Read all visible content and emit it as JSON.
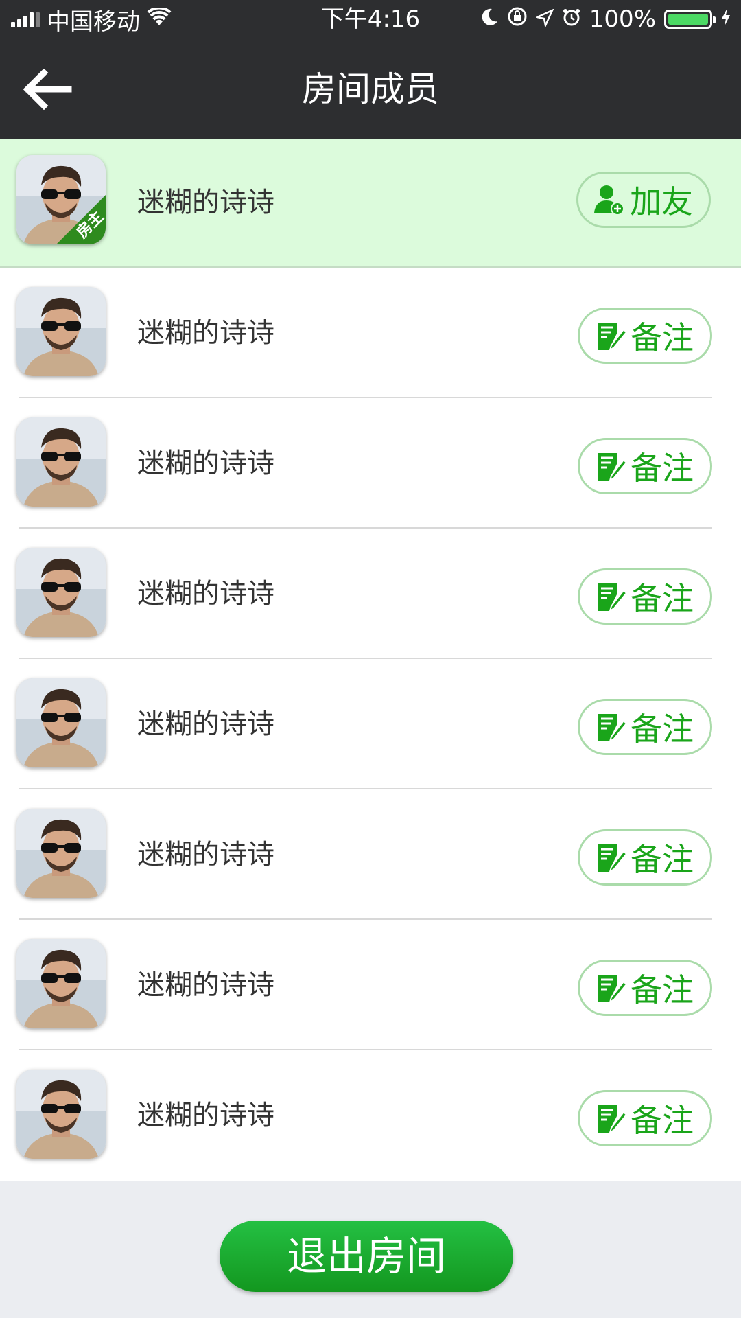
{
  "status_bar": {
    "carrier": "中国移动",
    "time": "下午4:16",
    "battery_percent": "100%",
    "icons": [
      "signal-icon",
      "wifi-icon",
      "moon-icon",
      "orientation-lock-icon",
      "location-icon",
      "alarm-icon",
      "battery-icon",
      "charging-icon"
    ]
  },
  "nav": {
    "title": "房间成员",
    "back_icon": "arrow-left-icon"
  },
  "colors": {
    "accent": "#1aa51a",
    "host_row_bg": "#dcfbdc",
    "nav_bg": "#2d2e30"
  },
  "members": [
    {
      "name": "迷糊的诗诗",
      "role_badge": "房主",
      "action_label": "加友",
      "action_icon": "add-friend-icon"
    },
    {
      "name": "迷糊的诗诗",
      "action_label": "备注",
      "action_icon": "edit-note-icon"
    },
    {
      "name": "迷糊的诗诗",
      "action_label": "备注",
      "action_icon": "edit-note-icon"
    },
    {
      "name": "迷糊的诗诗",
      "action_label": "备注",
      "action_icon": "edit-note-icon"
    },
    {
      "name": "迷糊的诗诗",
      "action_label": "备注",
      "action_icon": "edit-note-icon"
    },
    {
      "name": "迷糊的诗诗",
      "action_label": "备注",
      "action_icon": "edit-note-icon"
    },
    {
      "name": "迷糊的诗诗",
      "action_label": "备注",
      "action_icon": "edit-note-icon"
    },
    {
      "name": "迷糊的诗诗",
      "action_label": "备注",
      "action_icon": "edit-note-icon"
    }
  ],
  "footer": {
    "leave_label": "退出房间"
  }
}
